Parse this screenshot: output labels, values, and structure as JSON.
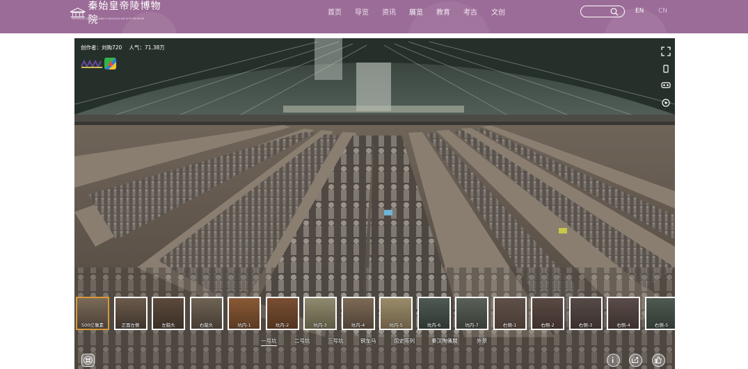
{
  "header": {
    "logo_text": "秦始皇帝陵博物院",
    "logo_subtitle": "EMPEROR QINSHIHUANG'S MAUSOLEUM SITE MUSEUM",
    "nav": [
      "首页",
      "导览",
      "资讯",
      "展览",
      "教育",
      "考古",
      "文创"
    ],
    "lang_en": "EN",
    "lang_cn": "CN",
    "colors": {
      "bar": "#9b6c97"
    }
  },
  "viewer": {
    "creator_label": "创作者：刘购720",
    "popularity_label": "人气：71.38万",
    "thumbnails": [
      {
        "label": "500亿像素",
        "selected": true
      },
      {
        "label": "正面左侧"
      },
      {
        "label": "左脑头"
      },
      {
        "label": "右脑头"
      },
      {
        "label": "坑内-1"
      },
      {
        "label": "坑内-2"
      },
      {
        "label": "坑内-3"
      },
      {
        "label": "坑内-4"
      },
      {
        "label": "坑内-5"
      },
      {
        "label": "坑内-6"
      },
      {
        "label": "坑内-7"
      },
      {
        "label": "右侧-1"
      },
      {
        "label": "右侧-2"
      },
      {
        "label": "右侧-3"
      },
      {
        "label": "右侧-4"
      },
      {
        "label": "右侧-5"
      }
    ],
    "groups": [
      "一号坑",
      "二号坑",
      "三号坑",
      "铜车马",
      "馆史陈列",
      "秦汉陶俑展",
      "外景"
    ],
    "active_group": "一号坑"
  }
}
